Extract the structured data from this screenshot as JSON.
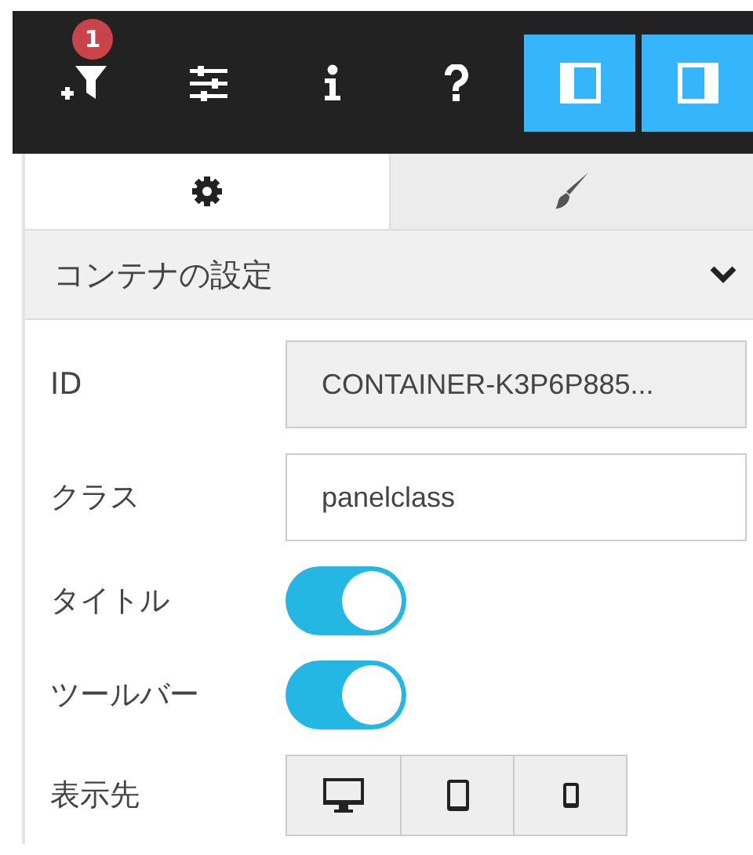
{
  "toolbar": [
    {
      "kind": "filter-add",
      "badge": "1",
      "active": false
    },
    {
      "kind": "sliders",
      "active": false
    },
    {
      "kind": "info",
      "active": false
    },
    {
      "kind": "help",
      "active": false
    },
    {
      "kind": "panel-left",
      "active": true
    },
    {
      "kind": "panel-right",
      "active": true
    }
  ],
  "tabs": [
    {
      "kind": "settings",
      "selected": true
    },
    {
      "kind": "style",
      "selected": false
    }
  ],
  "section": {
    "title": "コンテナの設定",
    "expanded": true
  },
  "fields": [
    {
      "kind": "text",
      "label": "ID",
      "value": "CONTAINER-K3P6P885...",
      "disabled": true
    },
    {
      "kind": "text",
      "label": "クラス",
      "value": "panelclass",
      "disabled": false
    },
    {
      "kind": "toggle",
      "label": "タイトル",
      "on": true
    },
    {
      "kind": "toggle",
      "label": "ツールバー",
      "on": true
    },
    {
      "kind": "devices",
      "label": "表示先",
      "options": [
        {
          "kind": "desktop",
          "selected": false
        },
        {
          "kind": "tablet",
          "selected": false
        },
        {
          "kind": "phone",
          "selected": false
        }
      ]
    }
  ]
}
